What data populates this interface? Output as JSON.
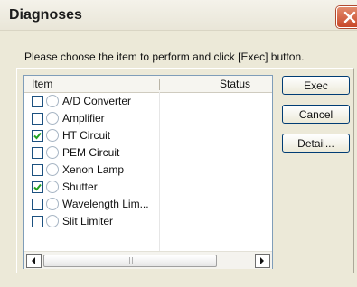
{
  "window": {
    "title": "Diagnoses"
  },
  "instructions": "Please choose the item to perform and click [Exec] button.",
  "list": {
    "columns": [
      "Item",
      "Status"
    ],
    "items": [
      {
        "label": "A/D Converter",
        "checked": false
      },
      {
        "label": "Amplifier",
        "checked": false
      },
      {
        "label": "HT Circuit",
        "checked": true
      },
      {
        "label": "PEM Circuit",
        "checked": false
      },
      {
        "label": "Xenon Lamp",
        "checked": false
      },
      {
        "label": "Shutter",
        "checked": true
      },
      {
        "label": "Wavelength Lim...",
        "checked": false
      },
      {
        "label": "Slit Limiter",
        "checked": false
      }
    ]
  },
  "buttons": {
    "exec": "Exec",
    "cancel": "Cancel",
    "detail": "Detail..."
  }
}
